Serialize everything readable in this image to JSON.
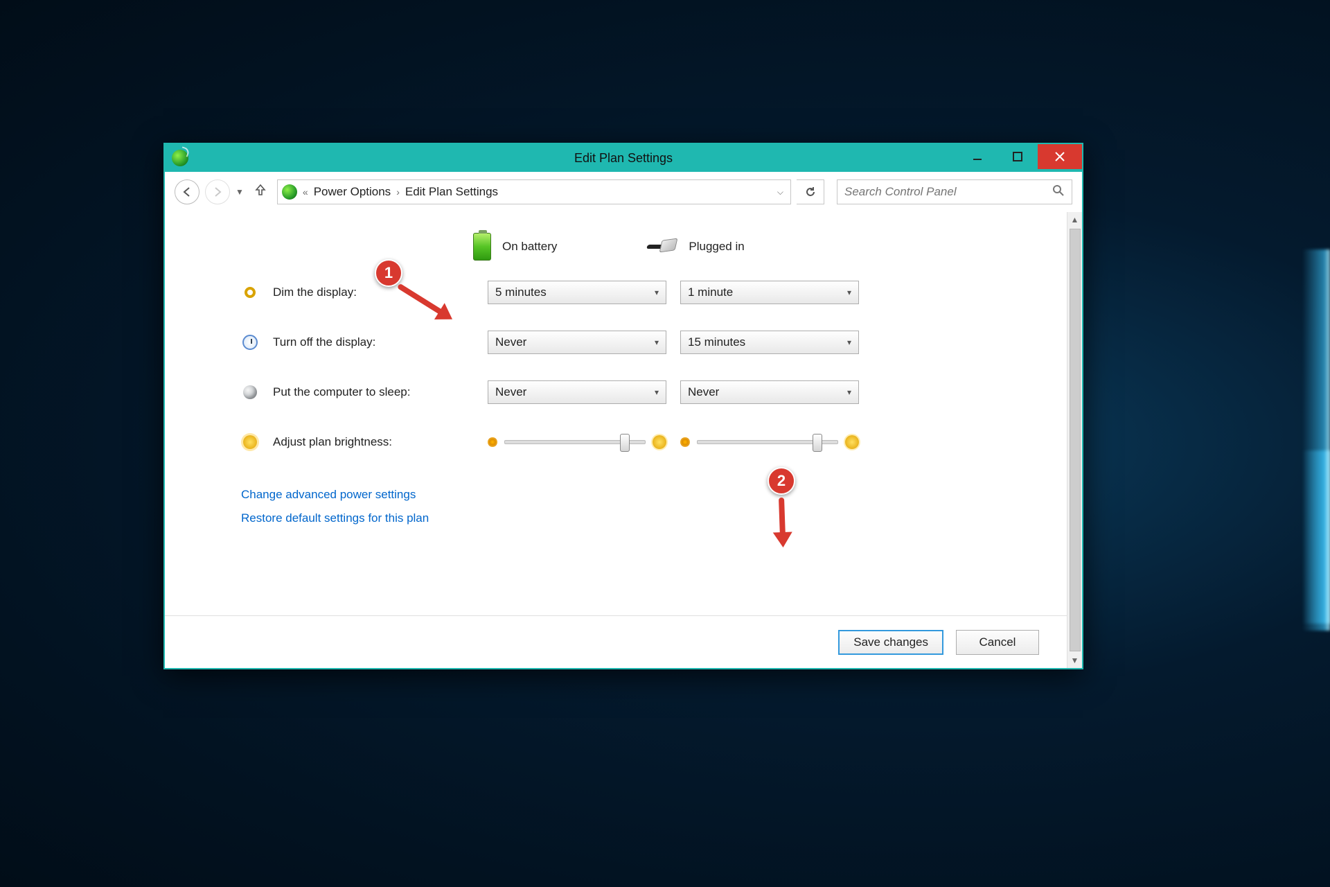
{
  "titlebar": {
    "title": "Edit Plan Settings"
  },
  "nav": {
    "crumb_prefix": "«",
    "crumb1": "Power Options",
    "crumb2": "Edit Plan Settings"
  },
  "search": {
    "placeholder": "Search Control Panel"
  },
  "headers": {
    "battery": "On battery",
    "plugged": "Plugged in"
  },
  "rows": {
    "dim": {
      "label": "Dim the display:",
      "battery": "5 minutes",
      "plugged": "1 minute"
    },
    "off": {
      "label": "Turn off the display:",
      "battery": "Never",
      "plugged": "15 minutes"
    },
    "sleep": {
      "label": "Put the computer to sleep:",
      "battery": "Never",
      "plugged": "Never"
    },
    "bright": {
      "label": "Adjust plan brightness:"
    }
  },
  "links": {
    "advanced": "Change advanced power settings",
    "restore": "Restore default settings for this plan"
  },
  "footer": {
    "save": "Save changes",
    "cancel": "Cancel"
  },
  "annotations": {
    "one": "1",
    "two": "2"
  }
}
